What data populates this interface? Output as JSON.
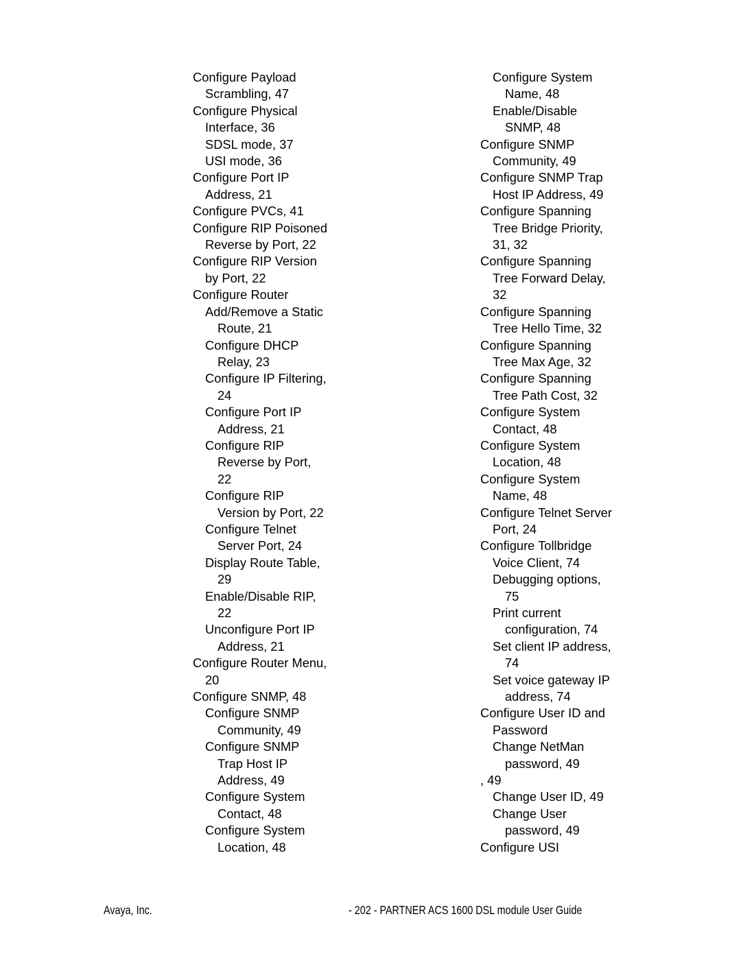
{
  "document": {
    "type": "index-page",
    "page_number_label": "- 202 -",
    "background_color": "#ffffff",
    "text_color": "#000000"
  },
  "index": {
    "left_column": [
      {
        "text": "Configure Payload",
        "level": 0
      },
      {
        "text": "Scrambling, 47",
        "level": 1
      },
      {
        "text": "Configure Physical",
        "level": 0
      },
      {
        "text": "Interface, 36",
        "level": 1
      },
      {
        "text": "SDSL mode, 37",
        "level": 1
      },
      {
        "text": "USI mode, 36",
        "level": 1
      },
      {
        "text": "Configure Port IP",
        "level": 0
      },
      {
        "text": "Address, 21",
        "level": 1
      },
      {
        "text": "Configure PVCs, 41",
        "level": 0
      },
      {
        "text": "Configure RIP Poisoned",
        "level": 0
      },
      {
        "text": "Reverse by Port, 22",
        "level": 1
      },
      {
        "text": "Configure RIP Version",
        "level": 0
      },
      {
        "text": "by Port, 22",
        "level": 1
      },
      {
        "text": "Configure Router",
        "level": 0
      },
      {
        "text": "Add/Remove a Static",
        "level": 1
      },
      {
        "text": "Route, 21",
        "level": 2
      },
      {
        "text": "Configure DHCP",
        "level": 1
      },
      {
        "text": "Relay, 23",
        "level": 2
      },
      {
        "text": "Configure IP Filtering,",
        "level": 1
      },
      {
        "text": "24",
        "level": 2
      },
      {
        "text": "Configure Port IP",
        "level": 1
      },
      {
        "text": "Address, 21",
        "level": 2
      },
      {
        "text": "Configure RIP",
        "level": 1
      },
      {
        "text": "Reverse by Port,",
        "level": 2
      },
      {
        "text": "22",
        "level": 2
      },
      {
        "text": "Configure RIP",
        "level": 1
      },
      {
        "text": "Version by Port, 22",
        "level": 2
      },
      {
        "text": "Configure Telnet",
        "level": 1
      },
      {
        "text": "Server Port, 24",
        "level": 2
      },
      {
        "text": "Display Route Table,",
        "level": 1
      },
      {
        "text": "29",
        "level": 2
      },
      {
        "text": "Enable/Disable RIP,",
        "level": 1
      },
      {
        "text": "22",
        "level": 2
      },
      {
        "text": "Unconfigure Port IP",
        "level": 1
      },
      {
        "text": "Address, 21",
        "level": 2
      },
      {
        "text": "Configure Router Menu,",
        "level": 0
      },
      {
        "text": "20",
        "level": 1
      },
      {
        "text": "Configure SNMP, 48",
        "level": 0
      },
      {
        "text": "Configure SNMP",
        "level": 1
      },
      {
        "text": "Community, 49",
        "level": 2
      },
      {
        "text": "Configure SNMP",
        "level": 1
      },
      {
        "text": "Trap Host IP",
        "level": 2
      },
      {
        "text": "Address, 49",
        "level": 2
      },
      {
        "text": "Configure System",
        "level": 1
      },
      {
        "text": "Contact, 48",
        "level": 2
      },
      {
        "text": "Configure System",
        "level": 1
      },
      {
        "text": "Location, 48",
        "level": 2
      }
    ],
    "right_column": [
      {
        "text": "Configure System",
        "level": 1
      },
      {
        "text": "Name, 48",
        "level": 2
      },
      {
        "text": "Enable/Disable",
        "level": 1
      },
      {
        "text": "SNMP, 48",
        "level": 2
      },
      {
        "text": "Configure SNMP",
        "level": 0
      },
      {
        "text": "Community, 49",
        "level": 1
      },
      {
        "text": "Configure SNMP Trap",
        "level": 0
      },
      {
        "text": "Host IP Address, 49",
        "level": 1
      },
      {
        "text": "Configure Spanning",
        "level": 0
      },
      {
        "text": "Tree Bridge Priority,",
        "level": 1
      },
      {
        "text": "31, 32",
        "level": 1
      },
      {
        "text": "Configure Spanning",
        "level": 0
      },
      {
        "text": "Tree Forward Delay,",
        "level": 1
      },
      {
        "text": "32",
        "level": 1
      },
      {
        "text": "Configure Spanning",
        "level": 0
      },
      {
        "text": "Tree Hello Time, 32",
        "level": 1
      },
      {
        "text": "Configure Spanning",
        "level": 0
      },
      {
        "text": "Tree Max Age, 32",
        "level": 1
      },
      {
        "text": "Configure Spanning",
        "level": 0
      },
      {
        "text": "Tree Path Cost, 32",
        "level": 1
      },
      {
        "text": "Configure System",
        "level": 0
      },
      {
        "text": "Contact, 48",
        "level": 1
      },
      {
        "text": "Configure System",
        "level": 0
      },
      {
        "text": "Location, 48",
        "level": 1
      },
      {
        "text": "Configure System",
        "level": 0
      },
      {
        "text": "Name, 48",
        "level": 1
      },
      {
        "text": "Configure Telnet Server",
        "level": 0
      },
      {
        "text": "Port, 24",
        "level": 1
      },
      {
        "text": "Configure Tollbridge",
        "level": 0
      },
      {
        "text": "Voice Client, 74",
        "level": 1
      },
      {
        "text": "Debugging options,",
        "level": 1
      },
      {
        "text": "75",
        "level": 2
      },
      {
        "text": "Print current",
        "level": 1
      },
      {
        "text": "configuration, 74",
        "level": 2
      },
      {
        "text": "Set client IP address,",
        "level": 1
      },
      {
        "text": "74",
        "level": 2
      },
      {
        "text": "Set voice gateway IP",
        "level": 1
      },
      {
        "text": "address, 74",
        "level": 2
      },
      {
        "text": "Configure User ID and",
        "level": 0
      },
      {
        "text": "Password",
        "level": 1
      },
      {
        "text": "Change NetMan",
        "level": 1
      },
      {
        "text": "password, 49",
        "level": 2
      },
      {
        "text": ", 49",
        "level": 0
      },
      {
        "text": "Change User ID, 49",
        "level": 1
      },
      {
        "text": "Change User",
        "level": 1
      },
      {
        "text": "password, 49",
        "level": 2
      },
      {
        "text": "Configure USI",
        "level": 0
      }
    ]
  },
  "footer": {
    "left": "Avaya, Inc.",
    "right": "- 202 - PARTNER ACS 1600 DSL module User Guide"
  }
}
